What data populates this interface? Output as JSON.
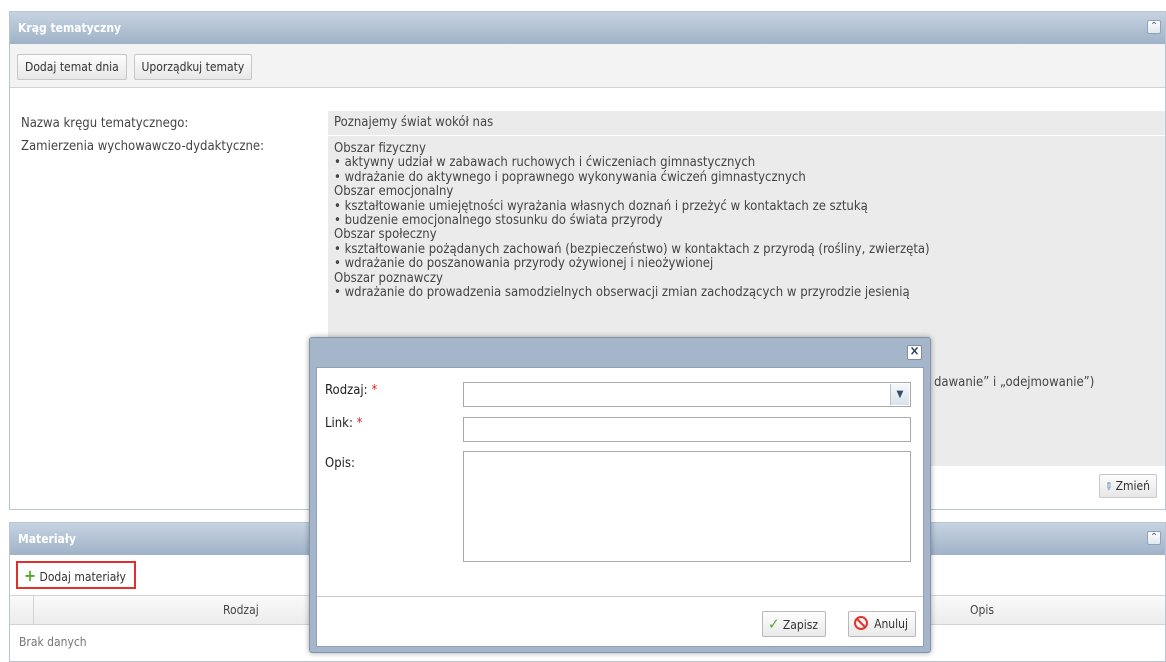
{
  "panel1": {
    "title": "Krąg tematyczny",
    "toolbar": {
      "add_topic_label": "Dodaj temat dnia",
      "order_topics_label": "Uporządkuj tematy"
    },
    "name_label": "Nazwa kręgu tematycznego:",
    "name_value": "Poznajemy świat wokół nas",
    "goals_label": "Zamierzenia wychowawczo-dydaktyczne:",
    "goals_lines": [
      "Obszar fizyczny",
      "• aktywny udział w zabawach ruchowych i ćwiczeniach gimnastycznych",
      "• wdrażanie do aktywnego i poprawnego wykonywania ćwiczeń gimnastycznych",
      "Obszar emocjonalny",
      "• kształtowanie umiejętności wyrażania własnych doznań i przeżyć w kontaktach ze sztuką",
      "• budzenie emocjonalnego stosunku do świata przyrody",
      "Obszar społeczny",
      "• kształtowanie pożądanych zachowań (bezpieczeństwo) w kontaktach z przyrodą (rośliny, zwierzęta)",
      "• wdrażanie do poszanowania przyrody ożywionej i nieożywionej",
      "Obszar poznawczy",
      "• wdrażanie do prowadzenia samodzielnych obserwacji zmian zachodzących w przyrodzie jesienią"
    ],
    "goals_partial_text": "dawanie” i „odejmowanie”)",
    "change_label": "Zmień"
  },
  "panel2": {
    "title": "Materiały",
    "add_materials_label": "Dodaj materiały",
    "columns": [
      "Rodzaj",
      "Opis"
    ],
    "empty_text": "Brak danych"
  },
  "modal": {
    "fields": {
      "type_label": "Rodzaj:",
      "link_label": "Link:",
      "desc_label": "Opis:",
      "required_mark": "*"
    },
    "values": {
      "type": "",
      "link": "",
      "desc": ""
    },
    "save_label": "Zapisz",
    "cancel_label": "Anuluj"
  }
}
